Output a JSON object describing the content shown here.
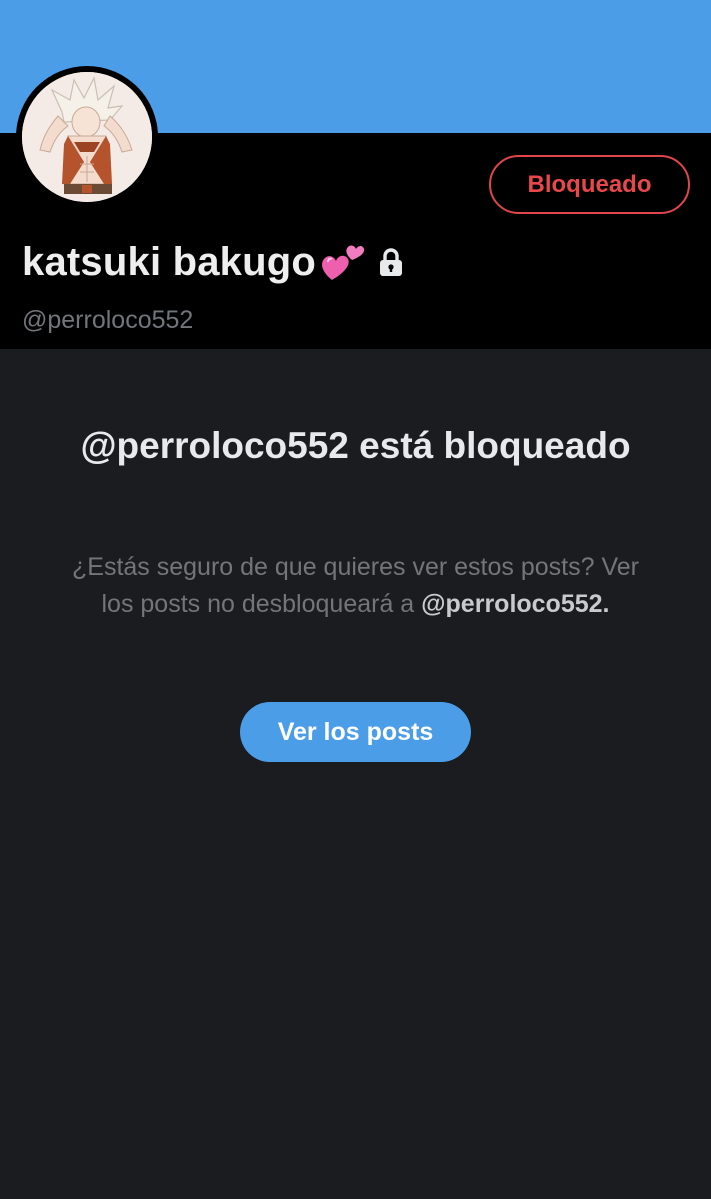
{
  "profile": {
    "display_name": "katsuki bakugo",
    "handle": "@perroloco552",
    "blocked_button_label": "Bloqueado",
    "avatar_icon": "anime-character-avatar",
    "name_emoji_icon": "two-hearts-icon",
    "protected_icon": "lock-icon"
  },
  "blocked_notice": {
    "title": "@perroloco552 está bloqueado",
    "description_text": "¿Estás seguro de que quieres ver estos posts? Ver los posts no desbloqueará a ",
    "description_handle": "@perroloco552",
    "description_end": ".",
    "view_posts_label": "Ver los posts"
  },
  "colors": {
    "banner": "#4c9de8",
    "header_bg": "#000000",
    "body_bg": "#1b1c1f",
    "blocked_red": "#e0454b",
    "accent_blue": "#4c9de8",
    "muted_text": "#71767b"
  }
}
